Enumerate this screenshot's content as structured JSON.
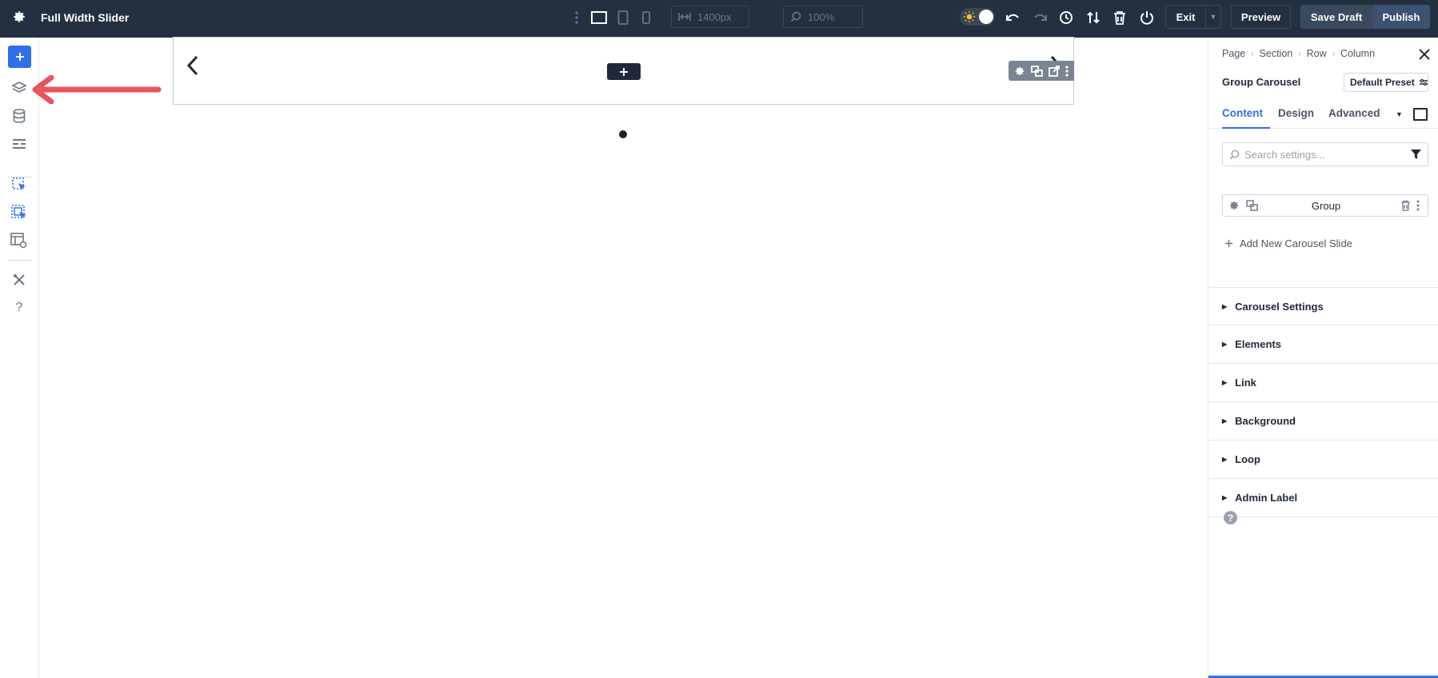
{
  "topbar": {
    "title": "Full Width Slider",
    "width_value": "1400px",
    "zoom_value": "100%",
    "exit_label": "Exit",
    "preview_label": "Preview",
    "save_draft_label": "Save Draft",
    "publish_label": "Publish"
  },
  "panel": {
    "breadcrumb": [
      "Page",
      "Section",
      "Row",
      "Column"
    ],
    "title": "Group Carousel",
    "preset_label": "Default Preset",
    "tabs": [
      "Content",
      "Design",
      "Advanced"
    ],
    "search_placeholder": "Search settings...",
    "group_item_label": "Group",
    "add_slide_label": "Add New Carousel Slide",
    "sections": [
      "Carousel Settings",
      "Elements",
      "Link",
      "Background",
      "Loop",
      "Admin Label"
    ],
    "help_glyph": "?"
  },
  "colors": {
    "topbar_bg": "#243040",
    "accent_blue": "#2f6fea",
    "arrow_red": "#e8545a"
  }
}
